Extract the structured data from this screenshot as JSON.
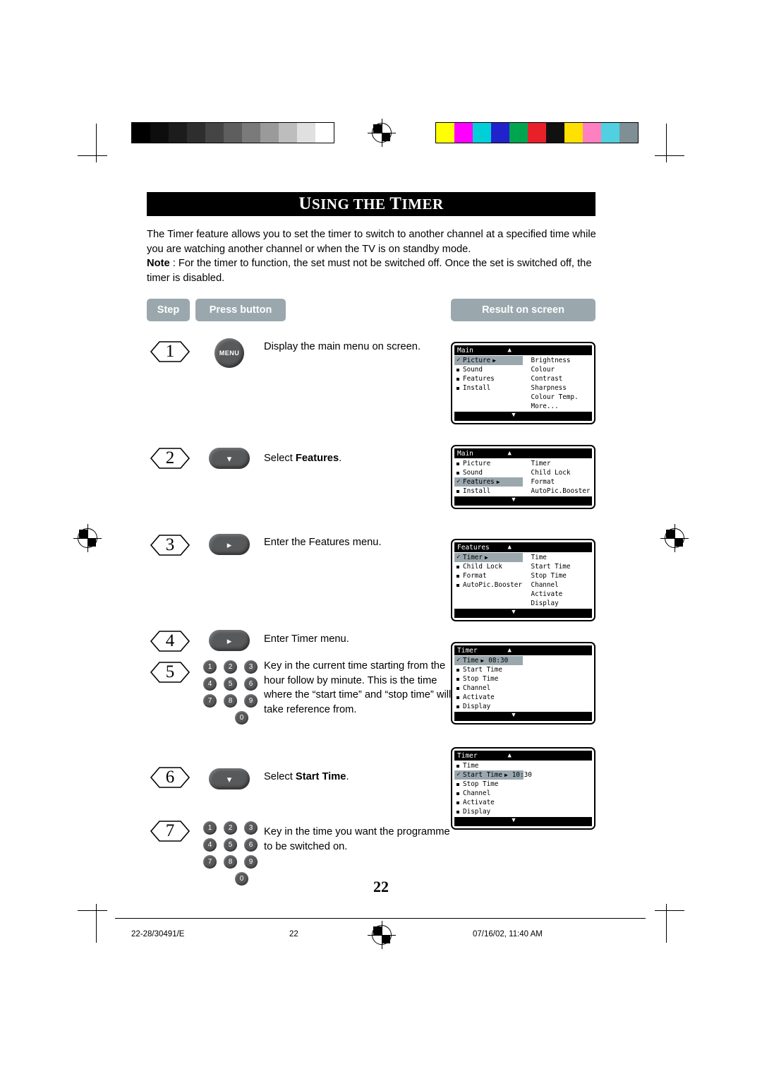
{
  "title": {
    "lead": "U",
    "rest1": "SING THE ",
    "lead2": "T",
    "rest2": "IMER",
    "full": "USING THE TIMER"
  },
  "intro": {
    "p1": "The Timer feature allows you to set the timer to switch to another channel at a specified time while you are watching another channel or when the TV is on standby mode.",
    "note_label": "Note",
    "note_body": " : For the timer to function, the set must not be switched off. Once the set is switched off, the timer is disabled."
  },
  "headers": {
    "step": "Step",
    "press_button": "Press button",
    "result_on_screen": "Result on screen"
  },
  "steps": [
    {
      "num": "1",
      "text": "Display the main menu on screen.",
      "button": "MENU"
    },
    {
      "num": "2",
      "text_plain": "Select ",
      "text_bold": "Features",
      "text_tail": ".",
      "button": "down-arrow"
    },
    {
      "num": "3",
      "text": "Enter the Features menu.",
      "button": "right-arrow"
    },
    {
      "num": "4",
      "text": "Enter Timer menu.",
      "button": "right-arrow"
    },
    {
      "num": "5",
      "text": "Key in the current time starting from the hour follow by minute. This is the time where the “start time” and “stop time” will take reference from.",
      "button": "keypad"
    },
    {
      "num": "6",
      "text_plain": "Select ",
      "text_bold": "Start Time",
      "text_tail": ".",
      "button": "down-arrow"
    },
    {
      "num": "7",
      "text": "Key in the time you want the programme to be switched on.",
      "button": "keypad"
    }
  ],
  "keypad": {
    "keys": [
      "1",
      "2",
      "3",
      "4",
      "5",
      "6",
      "7",
      "8",
      "9",
      "0"
    ]
  },
  "osd": [
    {
      "title": "Main",
      "left": [
        {
          "label": "Picture",
          "mark": "check",
          "arrow": true,
          "hl": true
        },
        {
          "label": "Sound",
          "mark": "bullet"
        },
        {
          "label": "Features",
          "mark": "bullet"
        },
        {
          "label": "Install",
          "mark": "bullet"
        }
      ],
      "right": [
        "Brightness",
        "Colour",
        "Contrast",
        "Sharpness",
        "Colour Temp.",
        "More..."
      ]
    },
    {
      "title": "Main",
      "left": [
        {
          "label": "Picture",
          "mark": "bullet"
        },
        {
          "label": "Sound",
          "mark": "bullet"
        },
        {
          "label": "Features",
          "mark": "check",
          "arrow": true,
          "hl": true
        },
        {
          "label": "Install",
          "mark": "bullet"
        }
      ],
      "right": [
        "Timer",
        "Child Lock",
        "Format",
        "AutoPic.Booster"
      ]
    },
    {
      "title": "Features",
      "left": [
        {
          "label": "Timer",
          "mark": "check",
          "arrow": true,
          "hl": true
        },
        {
          "label": "Child Lock",
          "mark": "bullet"
        },
        {
          "label": "Format",
          "mark": "bullet"
        },
        {
          "label": "AutoPic.Booster",
          "mark": "bullet"
        }
      ],
      "right": [
        "Time",
        "Start Time",
        "Stop Time",
        "Channel",
        "Activate",
        "Display"
      ]
    },
    {
      "title": "Timer",
      "left": [
        {
          "label": "Time",
          "mark": "check",
          "arrow": true,
          "hl": true,
          "value": "08:30"
        },
        {
          "label": "Start Time",
          "mark": "bullet"
        },
        {
          "label": "Stop Time",
          "mark": "bullet"
        },
        {
          "label": "Channel",
          "mark": "bullet"
        },
        {
          "label": "Activate",
          "mark": "bullet"
        },
        {
          "label": "Display",
          "mark": "bullet"
        }
      ],
      "right": []
    },
    {
      "title": "Timer",
      "left": [
        {
          "label": "Time",
          "mark": "bullet"
        },
        {
          "label": "Start Time",
          "mark": "check",
          "arrow": true,
          "hl": true,
          "value": "10:30"
        },
        {
          "label": "Stop Time",
          "mark": "bullet"
        },
        {
          "label": "Channel",
          "mark": "bullet"
        },
        {
          "label": "Activate",
          "mark": "bullet"
        },
        {
          "label": "Display",
          "mark": "bullet"
        }
      ],
      "right": []
    }
  ],
  "page_number": "22",
  "footer": {
    "left": "22-28/30491/E",
    "middle": "22",
    "right": "07/16/02, 11:40 AM"
  },
  "swatches": {
    "gray": [
      "#000000",
      "#0d0d0d",
      "#1c1c1c",
      "#2e2e2e",
      "#454545",
      "#5e5e5e",
      "#7a7a7a",
      "#9a9a9a",
      "#bdbdbd",
      "#e0e0e0",
      "#ffffff"
    ],
    "color": [
      "#ffff00",
      "#ff00ff",
      "#00cfd8",
      "#2222cc",
      "#00a550",
      "#e8202a",
      "#111111",
      "#ffe000",
      "#ff80c0",
      "#50d0e0",
      "#808f96"
    ]
  }
}
